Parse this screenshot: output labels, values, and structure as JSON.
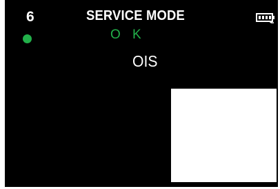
{
  "screen": {
    "mode_number": "6",
    "title": "SERVICE MODE",
    "status": "O K",
    "test_name": "OIS",
    "status_dot_color": "#22b04a",
    "status_text_color": "#22b04a",
    "battery_icon": "battery-icon",
    "status_icon": "status-dot-icon"
  }
}
